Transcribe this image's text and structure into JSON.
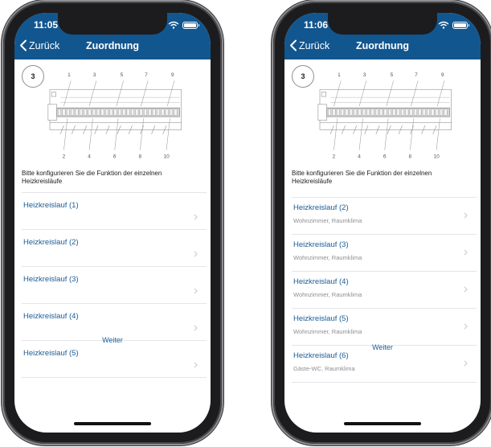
{
  "colors": {
    "nav_bg": "#12568f",
    "accent": "#1a5c96",
    "subtitle": "#8e8e93"
  },
  "icons": {
    "back": "chevron-left-icon",
    "row": "chevron-right-icon",
    "wifi": "wifi-icon",
    "battery": "battery-icon"
  },
  "screens": [
    {
      "status_time": "11:05",
      "back_label": "Zurück",
      "title": "Zuordnung",
      "step": "3",
      "diagram": {
        "top_labels": [
          "1",
          "3",
          "5",
          "7",
          "9"
        ],
        "bottom_labels": [
          "2",
          "4",
          "6",
          "8",
          "10"
        ]
      },
      "instruction": "Bitte konfigurieren Sie die Funktion der einzelnen Heizkreisläufe",
      "items": [
        {
          "title": "Heizkreislauf (1)",
          "subtitle": ""
        },
        {
          "title": "Heizkreislauf (2)",
          "subtitle": ""
        },
        {
          "title": "Heizkreislauf (3)",
          "subtitle": ""
        },
        {
          "title": "Heizkreislauf (4)",
          "subtitle": ""
        },
        {
          "title": "Heizkreislauf (5)",
          "subtitle": ""
        }
      ],
      "next_label": "Weiter"
    },
    {
      "status_time": "11:06",
      "back_label": "Zurück",
      "title": "Zuordnung",
      "step": "3",
      "diagram": {
        "top_labels": [
          "1",
          "3",
          "5",
          "7",
          "9"
        ],
        "bottom_labels": [
          "2",
          "4",
          "6",
          "8",
          "10"
        ]
      },
      "instruction": "Bitte konfigurieren Sie die Funktion der einzelnen Heizkreisläufe",
      "items": [
        {
          "title": "Heizkreislauf (2)",
          "subtitle": "Wohnzimmer, Raumklima"
        },
        {
          "title": "Heizkreislauf (3)",
          "subtitle": "Wohnzimmer, Raumklima"
        },
        {
          "title": "Heizkreislauf (4)",
          "subtitle": "Wohnzimmer, Raumklima"
        },
        {
          "title": "Heizkreislauf (5)",
          "subtitle": "Wohnzimmer, Raumklima"
        },
        {
          "title": "Heizkreislauf (6)",
          "subtitle": "Gäste-WC, Raumklima"
        }
      ],
      "next_label": "Weiter"
    }
  ]
}
